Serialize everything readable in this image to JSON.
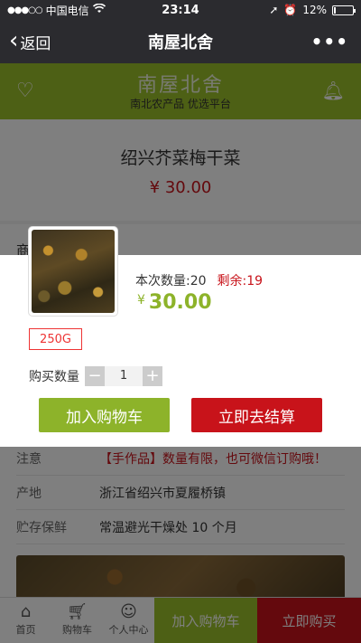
{
  "status": {
    "carrier": "中国电信",
    "time": "23:14",
    "battery": "12%",
    "battery_level": 0.12
  },
  "nav": {
    "back_label": "返回",
    "title": "南屋北舍",
    "more_label": "•••"
  },
  "brand": {
    "logo_text": "南屋北舍",
    "slogan": "南北农产品 优选平台"
  },
  "product": {
    "name": "绍兴芥菜梅干菜",
    "price": "¥ 30.00"
  },
  "details": {
    "tab_label": "商",
    "rows": [
      {
        "key": "注意",
        "value": "【手作品】数量有限，也可微信订购哦！"
      },
      {
        "key": "产地",
        "value": "浙江省绍兴市夏履桥镇"
      },
      {
        "key": "贮存保鲜",
        "value": "常温避光干燥处  10 个月"
      }
    ]
  },
  "tabbar": {
    "home": "首页",
    "cart": "购物车",
    "user": "个人中心",
    "add_cart": "加入购物车",
    "buy_now": "立即购买"
  },
  "sheet": {
    "stock_label": "本次数量:20",
    "remain_label": "剩余:19",
    "currency": "¥",
    "price": "30.00",
    "spec": "250G",
    "qty_label": "购买数量",
    "qty_minus": "−",
    "qty_value": "1",
    "qty_plus": "+",
    "add_cart_button": "加入购物车",
    "checkout_button": "立即去结算"
  },
  "colors": {
    "brand_green": "#8db32a",
    "accent_red": "#c8131a",
    "nav_dark": "#2b2b2f"
  }
}
